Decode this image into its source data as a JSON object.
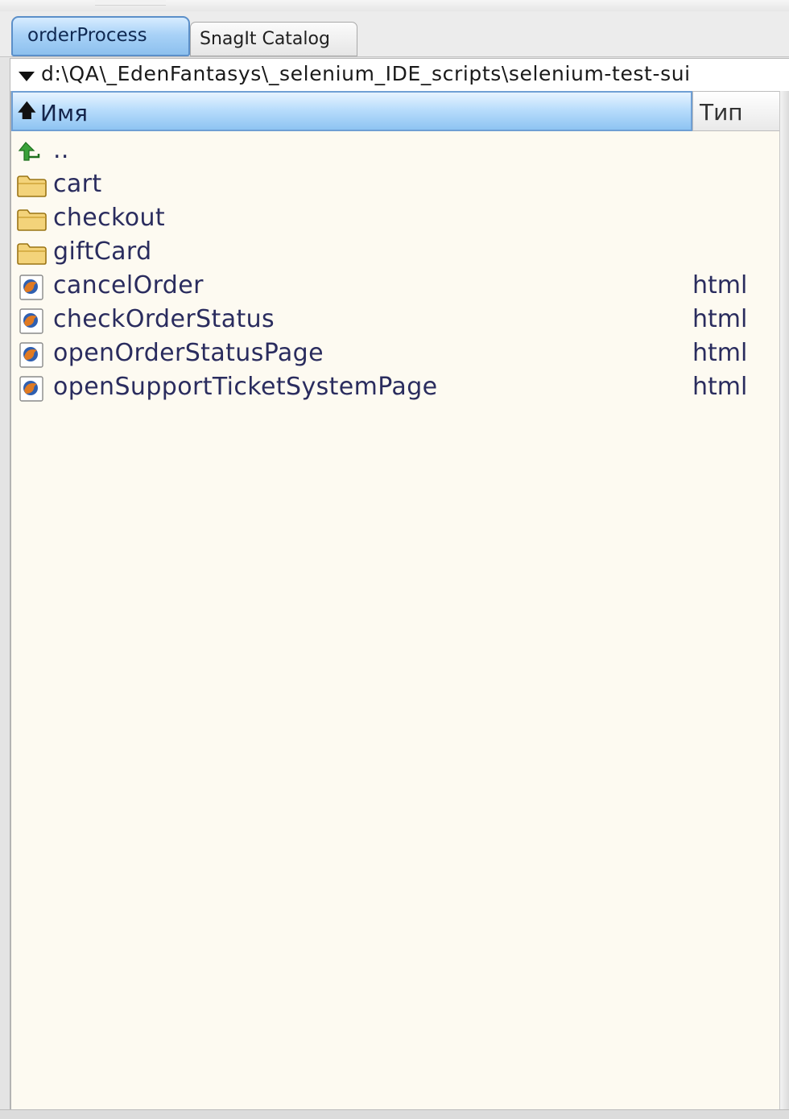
{
  "tabs": [
    {
      "label": "orderProcess",
      "active": true
    },
    {
      "label": "SnagIt Catalog",
      "active": false
    }
  ],
  "path_bar": {
    "path": "d:\\QA\\_EdenFantasys\\_selenium_IDE_scripts\\selenium-test-sui",
    "dropdown_icon": "chevron-down-icon"
  },
  "columns": {
    "sort_icon": "arrow-up-icon",
    "name_label": "Имя",
    "type_label": "Тип"
  },
  "rows": [
    {
      "name": "..",
      "type": "",
      "icon": "parent-folder-up-icon"
    },
    {
      "name": "cart",
      "type": "",
      "icon": "folder-icon"
    },
    {
      "name": "checkout",
      "type": "",
      "icon": "folder-icon"
    },
    {
      "name": "giftCard",
      "type": "",
      "icon": "folder-icon"
    },
    {
      "name": "cancelOrder",
      "type": "html",
      "icon": "html-file-icon"
    },
    {
      "name": "checkOrderStatus",
      "type": "html",
      "icon": "html-file-icon"
    },
    {
      "name": "openOrderStatusPage",
      "type": "html",
      "icon": "html-file-icon"
    },
    {
      "name": "openSupportTicketSystemPage",
      "type": "html",
      "icon": "html-file-icon"
    }
  ],
  "colors": {
    "panel_background": "#fdfaf1",
    "row_text": "#2a2c5e",
    "header_blue": "#8ec4f2"
  }
}
